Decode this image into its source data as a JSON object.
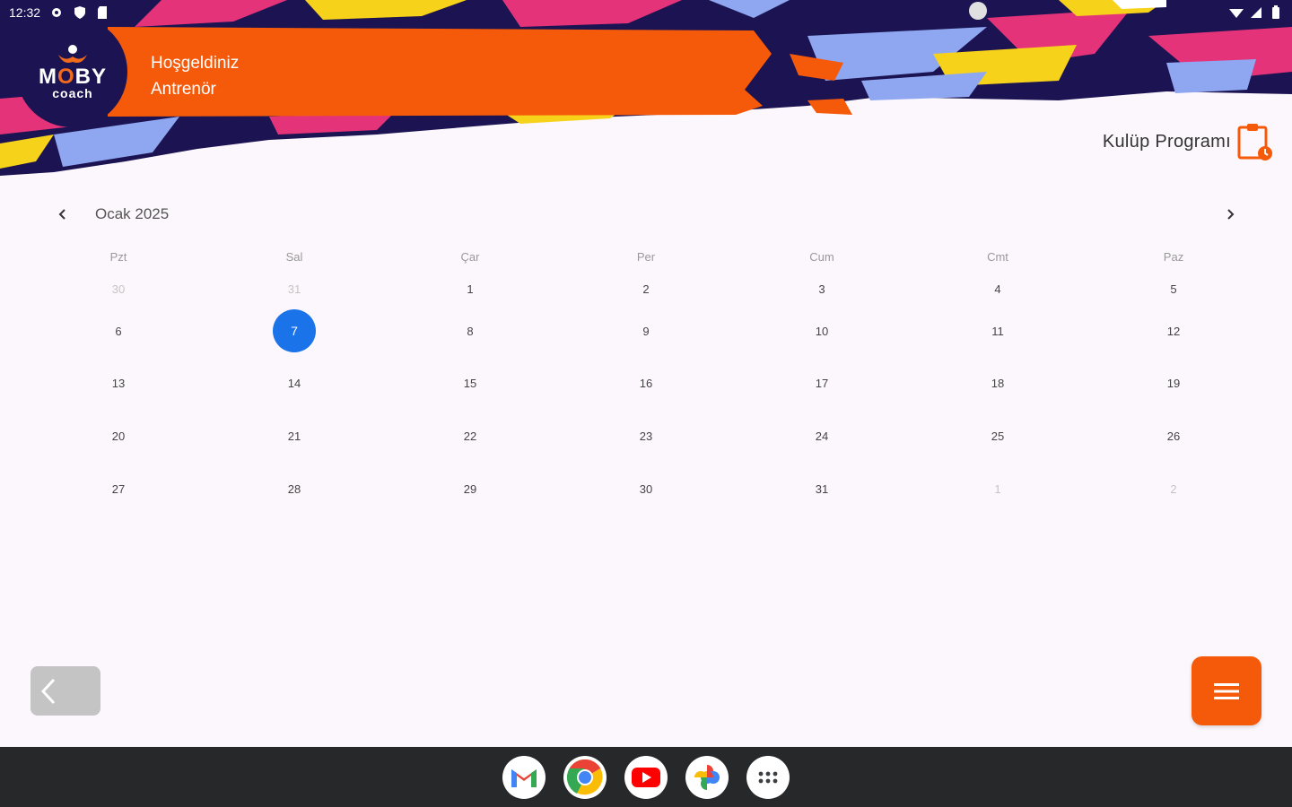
{
  "status_bar": {
    "time": "12:32"
  },
  "app": {
    "logo_main_pre": "M",
    "logo_main_o": "O",
    "logo_main_post": "BY",
    "logo_sub": "coach",
    "welcome_line1": "Hoşgeldiniz",
    "welcome_line2": "Antrenör",
    "club_program_label": "Kulüp Programı"
  },
  "calendar": {
    "month_label": "Ocak 2025",
    "weekdays": [
      "Pzt",
      "Sal",
      "Çar",
      "Per",
      "Cum",
      "Cmt",
      "Paz"
    ],
    "weeks": [
      [
        "30",
        "31",
        "1",
        "2",
        "3",
        "4",
        "5"
      ],
      [
        "6",
        "7",
        "8",
        "9",
        "10",
        "11",
        "12"
      ],
      [
        "13",
        "14",
        "15",
        "16",
        "17",
        "18",
        "19"
      ],
      [
        "20",
        "21",
        "22",
        "23",
        "24",
        "25",
        "26"
      ],
      [
        "27",
        "28",
        "29",
        "30",
        "31",
        "1",
        "2"
      ]
    ],
    "selected_day": "7"
  },
  "colors": {
    "accent": "#f55a0a",
    "selected": "#1a73e8",
    "navy": "#1c1452",
    "magenta": "#e5337a"
  },
  "dock": [
    "gmail-icon",
    "chrome-icon",
    "youtube-icon",
    "photos-icon",
    "app-drawer-icon"
  ]
}
